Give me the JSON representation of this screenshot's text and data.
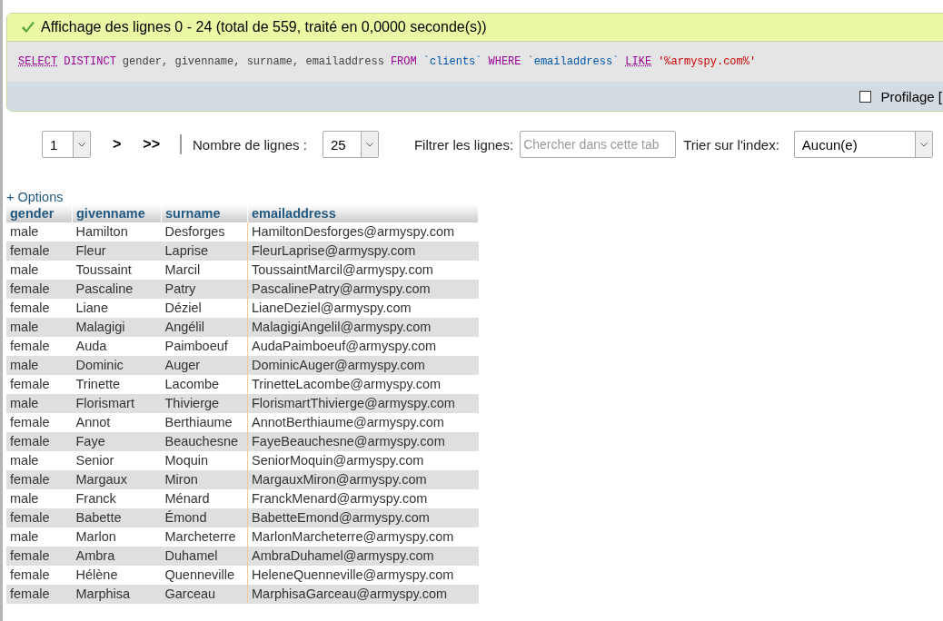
{
  "message": {
    "text": "Affichage des lignes 0 - 24 (total de 559, traité en 0,0000 seconde(s))"
  },
  "sql": [
    {
      "kind": "keyword",
      "text": "SELECT",
      "underline": true
    },
    {
      "kind": "keyword",
      "text": "DISTINCT",
      "underline": false
    },
    {
      "kind": "plain",
      "text": "gender, givenname, surname, emailaddress"
    },
    {
      "kind": "keyword",
      "text": "FROM",
      "underline": false
    },
    {
      "kind": "identifier",
      "text": "`clients`"
    },
    {
      "kind": "keyword",
      "text": "WHERE",
      "underline": false
    },
    {
      "kind": "identifier",
      "text": "`emailaddress`"
    },
    {
      "kind": "keyword",
      "text": "LIKE",
      "underline": true
    },
    {
      "kind": "string",
      "text": "'%armyspy.com%'"
    }
  ],
  "profiling": {
    "label": "Profilage [",
    "checked": false
  },
  "nav": {
    "page": "1",
    "next": ">",
    "last": ">>",
    "rows_label": "Nombre de lignes :",
    "rows": "25",
    "filter_label": "Filtrer les lignes:",
    "filter_placeholder": "Chercher dans cette tab",
    "sort_label": "Trier sur l'index:",
    "sort": "Aucun(e)"
  },
  "options_link": "+ Options",
  "table": {
    "columns": [
      "gender",
      "givenname",
      "surname",
      "emailaddress"
    ],
    "rows": [
      [
        "male",
        "Hamilton",
        "Desforges",
        "HamiltonDesforges@armyspy.com"
      ],
      [
        "female",
        "Fleur",
        "Laprise",
        "FleurLaprise@armyspy.com"
      ],
      [
        "male",
        "Toussaint",
        "Marcil",
        "ToussaintMarcil@armyspy.com"
      ],
      [
        "female",
        "Pascaline",
        "Patry",
        "PascalinePatry@armyspy.com"
      ],
      [
        "female",
        "Liane",
        "Déziel",
        "LianeDeziel@armyspy.com"
      ],
      [
        "male",
        "Malagigi",
        "Angélil",
        "MalagigiAngelil@armyspy.com"
      ],
      [
        "female",
        "Auda",
        "Paimboeuf",
        "AudaPaimboeuf@armyspy.com"
      ],
      [
        "male",
        "Dominic",
        "Auger",
        "DominicAuger@armyspy.com"
      ],
      [
        "female",
        "Trinette",
        "Lacombe",
        "TrinetteLacombe@armyspy.com"
      ],
      [
        "male",
        "Florismart",
        "Thivierge",
        "FlorismartThivierge@armyspy.com"
      ],
      [
        "female",
        "Annot",
        "Berthiaume",
        "AnnotBerthiaume@armyspy.com"
      ],
      [
        "female",
        "Faye",
        "Beauchesne",
        "FayeBeauchesne@armyspy.com"
      ],
      [
        "male",
        "Senior",
        "Moquin",
        "SeniorMoquin@armyspy.com"
      ],
      [
        "female",
        "Margaux",
        "Miron",
        "MargauxMiron@armyspy.com"
      ],
      [
        "male",
        "Franck",
        "Ménard",
        "FranckMenard@armyspy.com"
      ],
      [
        "female",
        "Babette",
        "Émond",
        "BabetteEmond@armyspy.com"
      ],
      [
        "male",
        "Marlon",
        "Marcheterre",
        "MarlonMarcheterre@armyspy.com"
      ],
      [
        "female",
        "Ambra",
        "Duhamel",
        "AmbraDuhamel@armyspy.com"
      ],
      [
        "female",
        "Hélène",
        "Quenneville",
        "HeleneQuenneville@armyspy.com"
      ],
      [
        "female",
        "Marphisa",
        "Garceau",
        "MarphisaGarceau@armyspy.com"
      ]
    ]
  }
}
